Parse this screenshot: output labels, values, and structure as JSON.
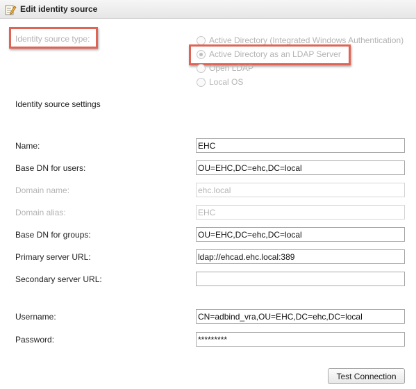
{
  "dialog": {
    "title": "Edit identity source",
    "icon": "edit-document-icon"
  },
  "identity_source_type": {
    "label": "Identity source type:",
    "options": [
      {
        "label": "Active Directory (Integrated Windows Authentication)",
        "checked": false,
        "disabled": true
      },
      {
        "label": "Active Directory as an LDAP Server",
        "checked": true,
        "disabled": true
      },
      {
        "label": "Open LDAP",
        "checked": false,
        "disabled": true
      },
      {
        "label": "Local OS",
        "checked": false,
        "disabled": true
      }
    ]
  },
  "settings": {
    "title": "Identity source settings",
    "fields": {
      "name": {
        "label": "Name:",
        "value": "EHC"
      },
      "base_dn_users": {
        "label": "Base DN for users:",
        "value": "OU=EHC,DC=ehc,DC=local"
      },
      "domain_name": {
        "label": "Domain name:",
        "value": "ehc.local",
        "disabled": true
      },
      "domain_alias": {
        "label": "Domain alias:",
        "value": "EHC",
        "disabled": true
      },
      "base_dn_groups": {
        "label": "Base DN for groups:",
        "value": "OU=EHC,DC=ehc,DC=local"
      },
      "primary_url": {
        "label": "Primary server URL:",
        "value": "ldap://ehcad.ehc.local:389"
      },
      "secondary_url": {
        "label": "Secondary server URL:",
        "value": ""
      },
      "username": {
        "label": "Username:",
        "value": "CN=adbind_vra,OU=EHC,DC=ehc,DC=local"
      },
      "password": {
        "label": "Password:",
        "value": "*********"
      }
    }
  },
  "buttons": {
    "test_connection": "Test Connection"
  },
  "colors": {
    "highlight_border": "#e06455",
    "disabled_text": "#b4b4b4"
  }
}
